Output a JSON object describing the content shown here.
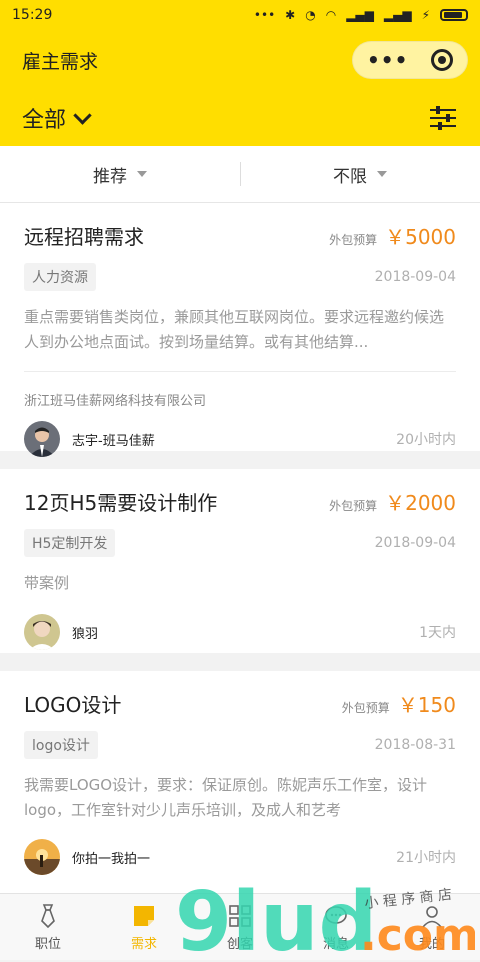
{
  "status_bar": {
    "time": "15:29",
    "signal_text": "•••"
  },
  "nav": {
    "title": "雇主需求"
  },
  "filter": {
    "category": "全部"
  },
  "sort": {
    "left": "推荐",
    "right": "不限"
  },
  "cards": [
    {
      "title": "远程招聘需求",
      "budget_label": "外包预算",
      "price": "￥5000",
      "tag": "人力资源",
      "date": "2018-09-04",
      "desc": "重点需要销售类岗位，兼顾其他互联网岗位。要求远程邀约候选人到办公地点面试。按到场量结算。或有其他结算...",
      "company": "浙江班马佳薪网络科技有限公司",
      "user": "志宇-班马佳薪",
      "time": "20小时内"
    },
    {
      "title": "12页H5需要设计制作",
      "budget_label": "外包预算",
      "price": "￥2000",
      "tag": "H5定制开发",
      "date": "2018-09-04",
      "desc": "带案例",
      "user": "狼羽",
      "time": "1天内"
    },
    {
      "title": "LOGO设计",
      "budget_label": "外包预算",
      "price": "￥150",
      "tag": "logo设计",
      "date": "2018-08-31",
      "desc": "我需要LOGO设计，要求：保证原创。陈妮声乐工作室，设计logo，工作室针对少儿声乐培训，及成人和艺考",
      "user": "你拍一我拍一",
      "time": "21小时内"
    }
  ],
  "tabs": [
    {
      "label": "职位",
      "icon": "tie-icon"
    },
    {
      "label": "需求",
      "icon": "note-icon",
      "active": true
    },
    {
      "label": "创客",
      "icon": "grid-icon"
    },
    {
      "label": "消息",
      "icon": "chat-icon"
    },
    {
      "label": "我的",
      "icon": "person-icon"
    }
  ],
  "watermark": {
    "brand": "9lud.com",
    "cn": "小程序商店"
  },
  "colors": {
    "accent": "#ffde00",
    "price": "#f08a1c",
    "active_tab": "#f3b600"
  }
}
